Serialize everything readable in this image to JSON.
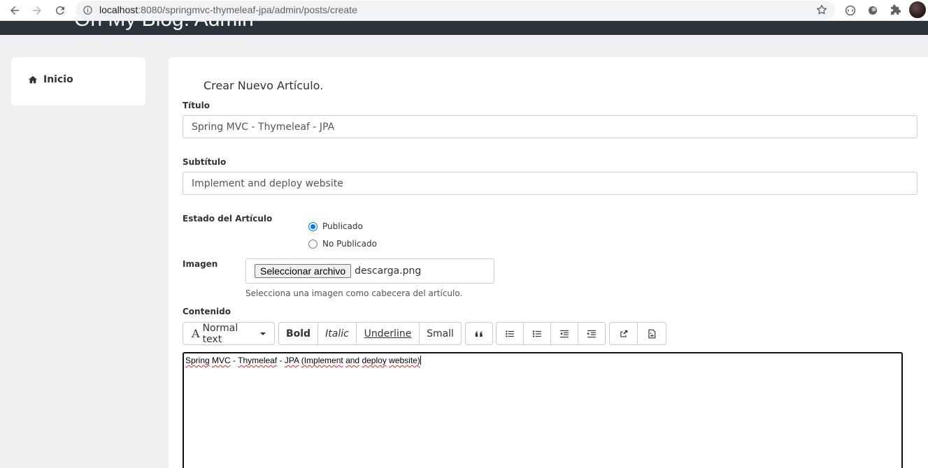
{
  "browser": {
    "url_host": "localhost",
    "url_path": ":8080/springmvc-thymeleaf-jpa/admin/posts/create"
  },
  "site": {
    "title": "On My Blog: Admin"
  },
  "sidebar": {
    "items": [
      {
        "label": "Inicio",
        "icon": "home-icon"
      }
    ]
  },
  "form": {
    "heading": "Crear Nuevo Artículo.",
    "title_label": "Título",
    "title_value": "Spring MVC - Thymeleaf - JPA",
    "subtitle_label": "Subtítulo",
    "subtitle_value": "Implement and deploy website",
    "status_label": "Estado del Artículo",
    "status_options": [
      "Publicado",
      "No Publicado"
    ],
    "status_selected": "Publicado",
    "image_label": "Imagen",
    "file_button": "Seleccionar archivo",
    "file_name": "descarga.png",
    "image_help": "Selecciona una imagen como cabecera del artículo.",
    "content_label": "Contenido"
  },
  "toolbar": {
    "font_style": "Normal text",
    "bold": "Bold",
    "italic": "Italic",
    "underline": "Underline",
    "small": "Small"
  },
  "editor": {
    "words": [
      "Spring",
      "MVC",
      "-",
      "Thymeleaf",
      "-",
      "JPA",
      "(Implement",
      "and",
      "deploy",
      "website)"
    ]
  },
  "colors": {
    "header_bg": "#2b343c",
    "page_bg": "#f0f0f2",
    "radio_accent": "#0075ff"
  }
}
